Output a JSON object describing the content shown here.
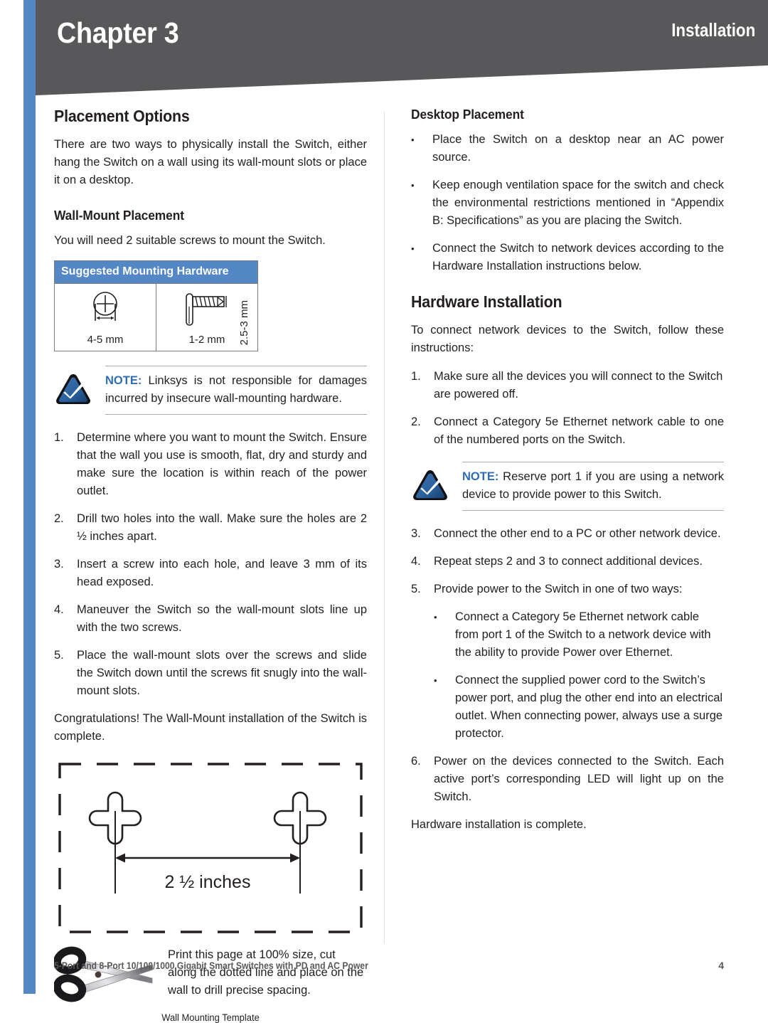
{
  "header": {
    "chapter": "Chapter 3",
    "section": "Installation",
    "band_color": "#58585a",
    "accent_color": "#5387c6"
  },
  "left_column": {
    "heading": "Placement Options",
    "intro": "There are two ways to physically install the Switch, either hang the Switch on a wall using its wall-mount slots or place it on a desktop.",
    "wall_heading": "Wall-Mount Placement",
    "wall_intro": "You will need 2 suitable screws to mount the Switch.",
    "hardware_table": {
      "title": "Suggested Mounting Hardware",
      "head_color": "#5387c6",
      "cells": [
        {
          "icon": "screw-head-icon",
          "label": "4-5 mm"
        },
        {
          "icon": "screw-side-icon",
          "label": "1-2 mm",
          "vertical_label": "2.5-3 mm"
        }
      ]
    },
    "note": {
      "icon": "linksys-note-checkmark-icon",
      "keyword": "NOTE:",
      "text": " Linksys is not responsible for damages incurred by insecure wall-mounting hardware."
    },
    "steps": [
      {
        "marker": "1.",
        "text": "Determine where you want to mount the Switch. Ensure that the wall you use is smooth, flat, dry and sturdy and make sure the location is within reach of the power outlet."
      },
      {
        "marker": "2.",
        "text": "Drill two holes into the wall. Make sure the holes are 2 ½ inches apart."
      },
      {
        "marker": "3.",
        "text": "Insert a screw into each hole, and leave 3 mm of its head exposed."
      },
      {
        "marker": "4.",
        "text": "Maneuver the Switch so the wall-mount slots line up with the two screws."
      },
      {
        "marker": "5.",
        "text": "Place the wall-mount slots over the screws and slide the Switch down until the screws fit snugly into the wall-mount slots."
      }
    ],
    "congrats": "Congratulations! The Wall-Mount installation of the Switch is complete.",
    "template": {
      "dimension_label": "2 ½ inches",
      "cut_icon": "scissors-icon",
      "cut_text": "Print this page at 100% size, cut along the dotted line and place on the wall to drill precise spacing.",
      "caption": "Wall Mounting Template"
    }
  },
  "right_column": {
    "desktop_heading": "Desktop Placement",
    "desktop_bullets": [
      "Place the Switch on a desktop near an AC power source.",
      "Keep enough ventilation space for the switch and check the environmental restrictions mentioned in “Appendix B: Specifications” as you are placing the Switch.",
      "Connect the Switch to network devices according to the Hardware Installation instructions below."
    ],
    "hardware_heading": "Hardware Installation",
    "hardware_intro": "To connect network devices to the Switch, follow these instructions:",
    "steps_before_note": [
      {
        "marker": "1.",
        "text": "Make sure all the devices you will connect to the Switch are powered off."
      },
      {
        "marker": "2.",
        "text": "Connect a Category 5e Ethernet network cable to one of the numbered ports on the Switch."
      }
    ],
    "note": {
      "icon": "linksys-note-checkmark-icon",
      "keyword": "NOTE:",
      "text": " Reserve port 1 if you are using a network device to provide power to this Switch."
    },
    "steps_after_note": [
      {
        "marker": "3.",
        "text": "Connect the other end to a PC or other network device."
      },
      {
        "marker": "4.",
        "text": "Repeat steps 2 and 3 to connect additional devices."
      },
      {
        "marker": "5.",
        "text": "Provide power to the Switch in one of two ways:"
      }
    ],
    "step5_subbullets": [
      "Connect a Category 5e Ethernet network cable from port 1 of the Switch to a network device with the ability to provide Power over Ethernet.",
      "Connect the supplied power cord to the Switch’s power port, and plug the other end into an electrical outlet. When connecting power, always use a surge protector."
    ],
    "step6": {
      "marker": "6.",
      "text": "Power on the devices connected to the Switch. Each active port’s corresponding LED will light up on the Switch."
    },
    "closing": "Hardware installation is complete."
  },
  "footer": {
    "title": "5-Port and 8-Port 10/100/1000 Gigabit Smart Switches with PD and AC Power",
    "page": "4"
  }
}
